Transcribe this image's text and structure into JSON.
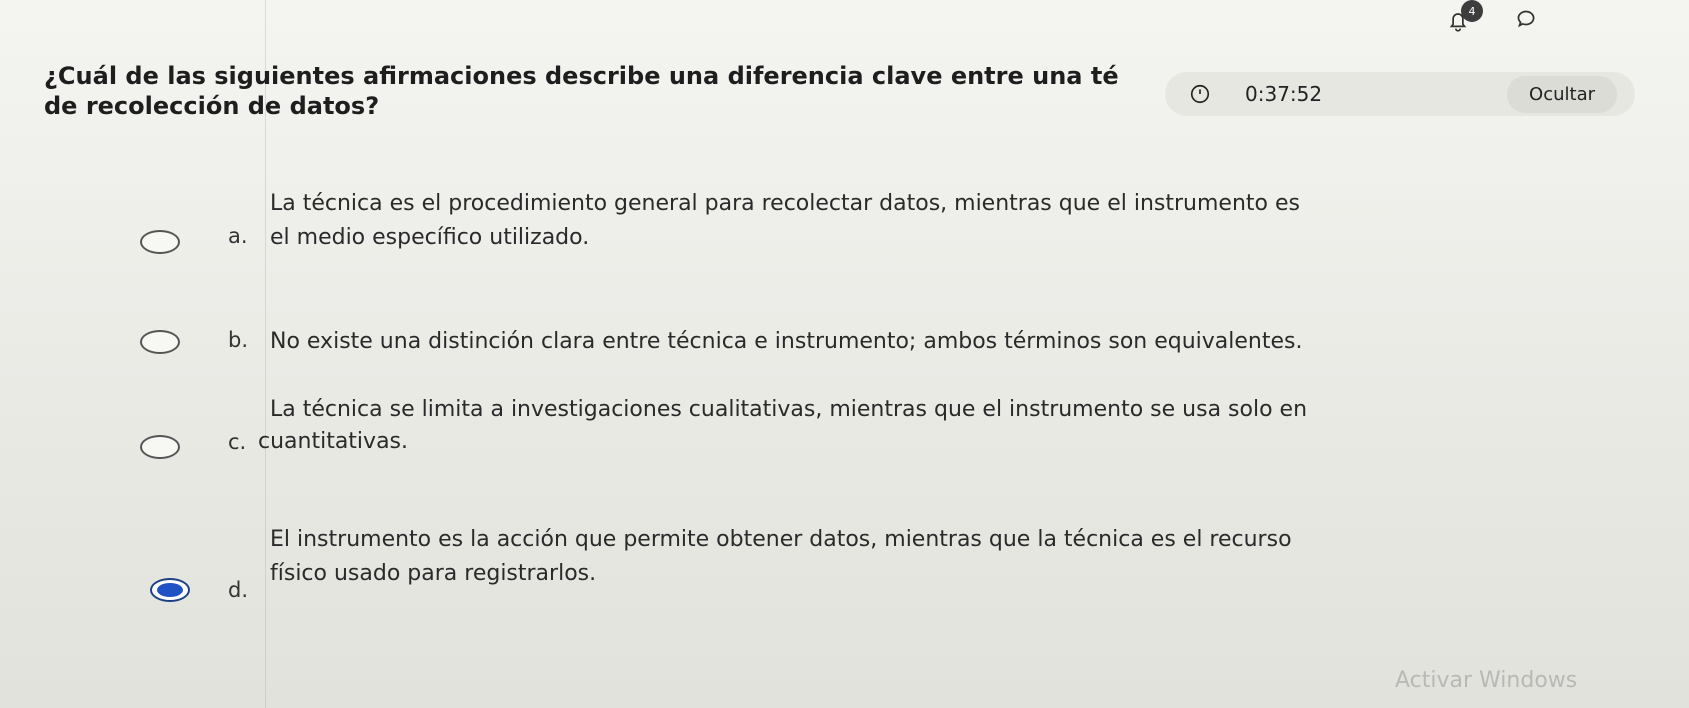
{
  "header": {
    "notification_count": "4"
  },
  "question": {
    "line1": "¿Cuál de las siguientes afirmaciones describe una diferencia clave entre una té",
    "line2": "de recolección de datos?"
  },
  "timer": {
    "value": "0:37:52",
    "hide_label": "Ocultar"
  },
  "options": [
    {
      "letter": "a.",
      "line1": "La técnica es el procedimiento general para recolectar datos, mientras que el instrumento es",
      "line2": "el medio específico utilizado.",
      "selected": false
    },
    {
      "letter": "b.",
      "line1": "No existe una distinción clara entre técnica e instrumento; ambos términos son equivalentes.",
      "selected": false
    },
    {
      "letter": "c.",
      "line1": "La técnica se limita a investigaciones cualitativas, mientras que el instrumento se usa solo en",
      "line2": "cuantitativas.",
      "selected": false
    },
    {
      "letter": "d.",
      "line1": "El instrumento es la acción que permite obtener datos, mientras que la técnica es el recurso",
      "line2": "físico usado para registrarlos.",
      "selected": true
    }
  ],
  "watermark": "Activar Windows",
  "icons": [
    "bell-icon",
    "chat-icon",
    "clock-icon"
  ]
}
